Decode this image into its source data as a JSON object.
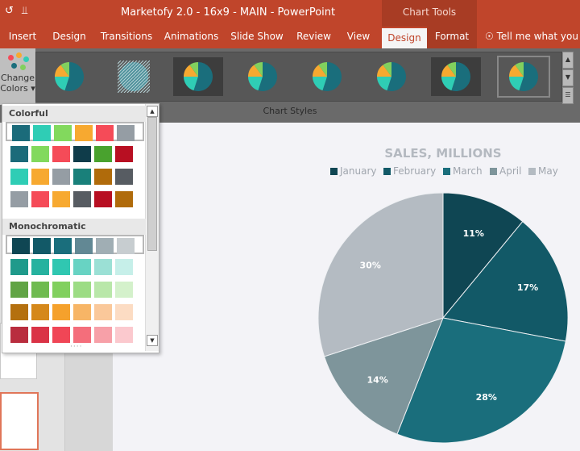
{
  "titlebar": {
    "title": "Marketofy 2.0 - 16x9 - MAIN  -  PowerPoint",
    "context_tab": "Chart Tools",
    "qat_icons": [
      "undo-icon",
      "customize-arrow-icon"
    ]
  },
  "ribbon_tabs": [
    {
      "label": "Insert"
    },
    {
      "label": "Design"
    },
    {
      "label": "Transitions"
    },
    {
      "label": "Animations"
    },
    {
      "label": "Slide Show"
    },
    {
      "label": "Review"
    },
    {
      "label": "View"
    },
    {
      "label": "Design",
      "active": true
    },
    {
      "label": "Format"
    },
    {
      "label": "Tell me what you wa",
      "icon": "lightbulb-icon"
    }
  ],
  "change_colors": {
    "line1": "Change",
    "line2": "Colors"
  },
  "chart_styles": {
    "group_label": "Chart Styles",
    "count": 8,
    "selected_index": 7
  },
  "color_dropdown": {
    "sections": [
      {
        "title": "Colorful",
        "rows": [
          [
            "#1b6b7a",
            "#2fcdb5",
            "#82d95d",
            "#f7a930",
            "#f54b58",
            "#959da4"
          ],
          [
            "#1b6b7a",
            "#82d95d",
            "#f54b58",
            "#0f3c4a",
            "#49a22e",
            "#b80f22"
          ],
          [
            "#2fcdb5",
            "#f7a930",
            "#959da4",
            "#19807a",
            "#b06b0b",
            "#575c62"
          ],
          [
            "#959da4",
            "#f54b58",
            "#f7a930",
            "#575c62",
            "#b80f22",
            "#b06b0b"
          ]
        ]
      },
      {
        "title": "Monochromatic",
        "rows": [
          [
            "#0f4653",
            "#125967",
            "#1a6e7c",
            "#628894",
            "#a0aeb4",
            "#c7cdd0"
          ],
          [
            "#1f9a8b",
            "#26b29f",
            "#30c7b1",
            "#68d3c3",
            "#9be0d5",
            "#c6efe9"
          ],
          [
            "#61a445",
            "#6fbb50",
            "#81d05e",
            "#9cdc84",
            "#b9e7a9",
            "#d4f1cb"
          ],
          [
            "#b4700f",
            "#d5881a",
            "#f5a12c",
            "#f7b566",
            "#fac89a",
            "#fcdcc3"
          ],
          [
            "#b92d3e",
            "#da3346",
            "#f04656",
            "#f46e7b",
            "#f7a0a8",
            "#fbc9ce"
          ]
        ]
      }
    ]
  },
  "chart_data": {
    "type": "pie",
    "title": "SALES, MILLIONS",
    "categories": [
      "January",
      "February",
      "March",
      "April",
      "May"
    ],
    "values": [
      11,
      17,
      28,
      14,
      30
    ],
    "labels": [
      "11%",
      "17%",
      "28%",
      "14%",
      "30%"
    ],
    "colors": [
      "#0f4653",
      "#125967",
      "#1a6e7c",
      "#7e959b",
      "#b4bbc2"
    ],
    "legend_colors": [
      "#0f4653",
      "#125967",
      "#1a6e7c",
      "#7e959b",
      "#b4bbc2"
    ],
    "legend": "top"
  },
  "style_thumb_colors": [
    "#1a6e7c",
    "#2fcdb5",
    "#f7a930",
    "#81d05e"
  ]
}
